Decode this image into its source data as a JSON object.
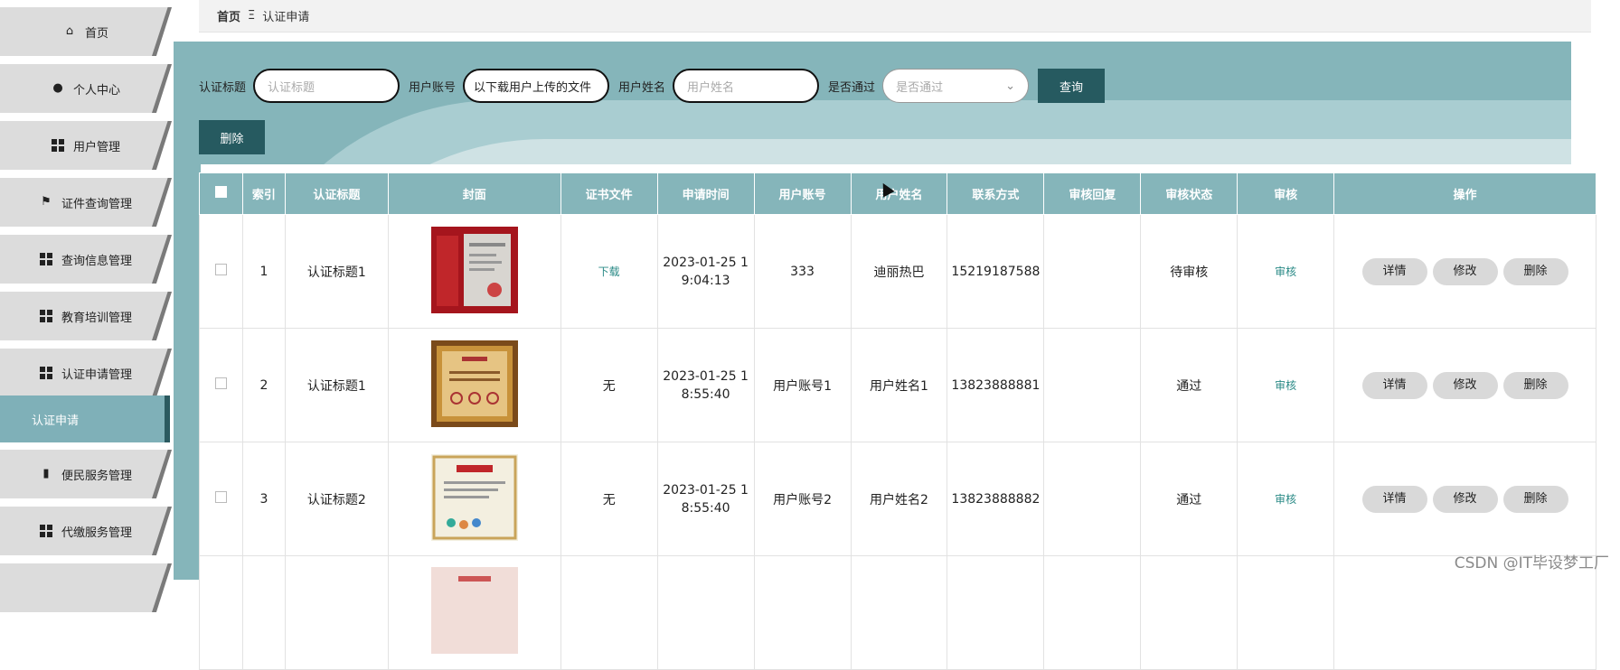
{
  "sidebar": {
    "items": [
      {
        "label": "首页",
        "icon": "home-icon"
      },
      {
        "label": "个人中心",
        "icon": "user-icon"
      },
      {
        "label": "用户管理",
        "icon": "grid-icon"
      },
      {
        "label": "证件查询管理",
        "icon": "flag-icon"
      },
      {
        "label": "查询信息管理",
        "icon": "grid-icon"
      },
      {
        "label": "教育培训管理",
        "icon": "grid-icon"
      },
      {
        "label": "认证申请管理",
        "icon": "grid-icon"
      },
      {
        "label": "便民服务管理",
        "icon": "bar-chart-icon"
      },
      {
        "label": "代缴服务管理",
        "icon": "grid-icon"
      }
    ],
    "active_sub": "认证申请"
  },
  "breadcrumb": {
    "home": "首页",
    "sep": "Ξ",
    "current": "认证申请"
  },
  "search": {
    "title_label": "认证标题",
    "title_placeholder": "认证标题",
    "account_label": "用户账号",
    "account_value": "以下载用户上传的文件",
    "name_label": "用户姓名",
    "name_placeholder": "用户姓名",
    "pass_label": "是否通过",
    "pass_placeholder": "是否通过",
    "query_button": "查询"
  },
  "delete_button": "删除",
  "table": {
    "headers": [
      "索引",
      "认证标题",
      "封面",
      "证书文件",
      "申请时间",
      "用户账号",
      "用户姓名",
      "联系方式",
      "审核回复",
      "审核状态",
      "审核",
      "操作"
    ],
    "rows": [
      {
        "index": "1",
        "title": "认证标题1",
        "file": "下载",
        "file_is_link": true,
        "time_line1": "2023-01-25 1",
        "time_line2": "9:04:13",
        "account": "333",
        "name": "迪丽热巴",
        "phone": "15219187588",
        "reply": "",
        "status": "待审核",
        "audit": "审核"
      },
      {
        "index": "2",
        "title": "认证标题1",
        "file": "无",
        "file_is_link": false,
        "time_line1": "2023-01-25 1",
        "time_line2": "8:55:40",
        "account": "用户账号1",
        "name": "用户姓名1",
        "phone": "13823888881",
        "reply": "",
        "status": "通过",
        "audit": "审核"
      },
      {
        "index": "3",
        "title": "认证标题2",
        "file": "无",
        "file_is_link": false,
        "time_line1": "2023-01-25 1",
        "time_line2": "8:55:40",
        "account": "用户账号2",
        "name": "用户姓名2",
        "phone": "13823888882",
        "reply": "",
        "status": "通过",
        "audit": "审核"
      }
    ],
    "actions": {
      "detail": "详情",
      "edit": "修改",
      "delete": "删除"
    }
  },
  "watermark": "CSDN @IT毕设梦工厂",
  "colors": {
    "teal": "#85b5ba",
    "teal_dark": "#265a60",
    "link": "#2a8a86"
  }
}
